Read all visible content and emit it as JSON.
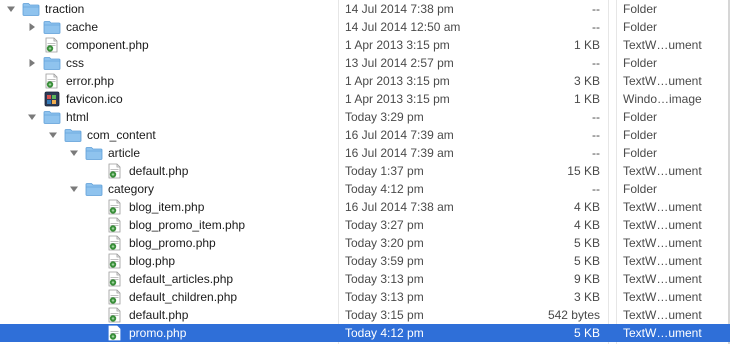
{
  "files": [
    {
      "name": "traction",
      "date": "14 Jul 2014 7:38 pm",
      "size": "--",
      "kind": "Folder",
      "depth": 0,
      "type": "folder",
      "disclosure": "open"
    },
    {
      "name": "cache",
      "date": "14 Jul 2014 12:50 am",
      "size": "--",
      "kind": "Folder",
      "depth": 1,
      "type": "folder",
      "disclosure": "closed"
    },
    {
      "name": "component.php",
      "date": "1 Apr 2013 3:15 pm",
      "size": "1 KB",
      "kind": "TextW…ument",
      "depth": 1,
      "type": "php",
      "disclosure": "none"
    },
    {
      "name": "css",
      "date": "13 Jul 2014 2:57 pm",
      "size": "--",
      "kind": "Folder",
      "depth": 1,
      "type": "folder",
      "disclosure": "closed"
    },
    {
      "name": "error.php",
      "date": "1 Apr 2013 3:15 pm",
      "size": "3 KB",
      "kind": "TextW…ument",
      "depth": 1,
      "type": "php",
      "disclosure": "none"
    },
    {
      "name": "favicon.ico",
      "date": "1 Apr 2013 3:15 pm",
      "size": "1 KB",
      "kind": "Windo…image",
      "depth": 1,
      "type": "ico",
      "disclosure": "none"
    },
    {
      "name": "html",
      "date": "Today 3:29 pm",
      "size": "--",
      "kind": "Folder",
      "depth": 1,
      "type": "folder",
      "disclosure": "open"
    },
    {
      "name": "com_content",
      "date": "16 Jul 2014 7:39 am",
      "size": "--",
      "kind": "Folder",
      "depth": 2,
      "type": "folder",
      "disclosure": "open"
    },
    {
      "name": "article",
      "date": "16 Jul 2014 7:39 am",
      "size": "--",
      "kind": "Folder",
      "depth": 3,
      "type": "folder",
      "disclosure": "open"
    },
    {
      "name": "default.php",
      "date": "Today 1:37 pm",
      "size": "15 KB",
      "kind": "TextW…ument",
      "depth": 4,
      "type": "php",
      "disclosure": "none"
    },
    {
      "name": "category",
      "date": "Today 4:12 pm",
      "size": "--",
      "kind": "Folder",
      "depth": 3,
      "type": "folder",
      "disclosure": "open"
    },
    {
      "name": "blog_item.php",
      "date": "16 Jul 2014 7:38 am",
      "size": "4 KB",
      "kind": "TextW…ument",
      "depth": 4,
      "type": "php",
      "disclosure": "none"
    },
    {
      "name": "blog_promo_item.php",
      "date": "Today 3:27 pm",
      "size": "4 KB",
      "kind": "TextW…ument",
      "depth": 4,
      "type": "php",
      "disclosure": "none"
    },
    {
      "name": "blog_promo.php",
      "date": "Today 3:20 pm",
      "size": "5 KB",
      "kind": "TextW…ument",
      "depth": 4,
      "type": "php",
      "disclosure": "none"
    },
    {
      "name": "blog.php",
      "date": "Today 3:59 pm",
      "size": "5 KB",
      "kind": "TextW…ument",
      "depth": 4,
      "type": "php",
      "disclosure": "none"
    },
    {
      "name": "default_articles.php",
      "date": "Today 3:13 pm",
      "size": "9 KB",
      "kind": "TextW…ument",
      "depth": 4,
      "type": "php",
      "disclosure": "none"
    },
    {
      "name": "default_children.php",
      "date": "Today 3:13 pm",
      "size": "3 KB",
      "kind": "TextW…ument",
      "depth": 4,
      "type": "php",
      "disclosure": "none"
    },
    {
      "name": "default.php",
      "date": "Today 3:15 pm",
      "size": "542 bytes",
      "kind": "TextW…ument",
      "depth": 4,
      "type": "php",
      "disclosure": "none"
    },
    {
      "name": "promo.php",
      "date": "Today 4:12 pm",
      "size": "5 KB",
      "kind": "TextW…ument",
      "depth": 4,
      "type": "php",
      "disclosure": "none",
      "selected": true
    }
  ],
  "colors": {
    "folder": "#8fc3ee",
    "folder_dark": "#5e9fd8",
    "selection": "#2f6fd8",
    "disclosure": "#7a7a7a"
  },
  "icons": {
    "folder": "folder-icon",
    "php": "php-document-icon",
    "ico": "ico-image-icon",
    "disclosure_open": "disclosure-open-icon",
    "disclosure_closed": "disclosure-closed-icon"
  }
}
